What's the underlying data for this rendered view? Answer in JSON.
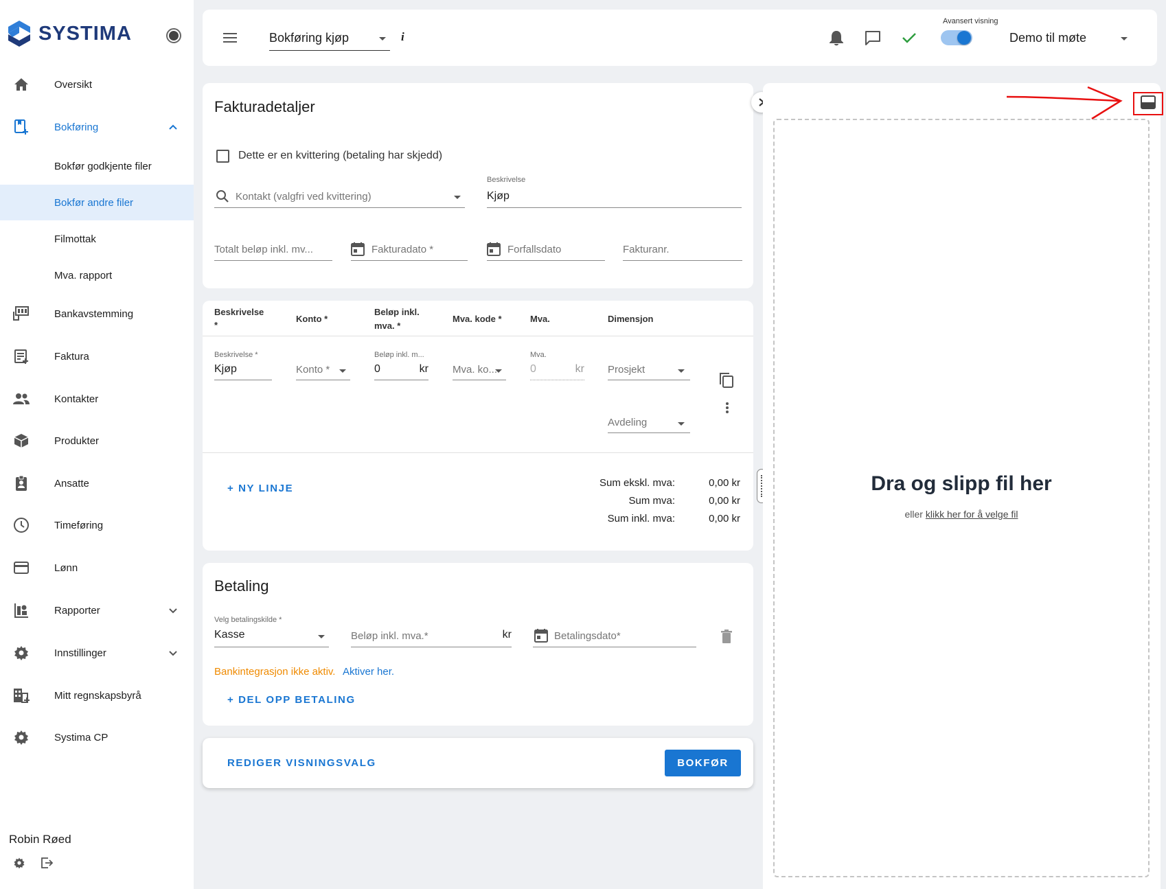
{
  "brand": {
    "name": "SYSTIMA"
  },
  "sidebar": {
    "items": [
      {
        "label": "Oversikt",
        "icon": "home-icon"
      },
      {
        "label": "Bokføring",
        "icon": "book-add-icon"
      },
      {
        "label": "Bokfør godkjente filer"
      },
      {
        "label": "Bokfør andre filer"
      },
      {
        "label": "Filmottak"
      },
      {
        "label": "Mva. rapport"
      },
      {
        "label": "Bankavstemming",
        "icon": "bank-reconcile-icon"
      },
      {
        "label": "Faktura",
        "icon": "invoice-icon"
      },
      {
        "label": "Kontakter",
        "icon": "people-icon"
      },
      {
        "label": "Produkter",
        "icon": "box-icon"
      },
      {
        "label": "Ansatte",
        "icon": "badge-icon"
      },
      {
        "label": "Timeføring",
        "icon": "clock-icon"
      },
      {
        "label": "Lønn",
        "icon": "card-icon"
      },
      {
        "label": "Rapporter",
        "icon": "report-icon"
      },
      {
        "label": "Innstillinger",
        "icon": "gear-icon"
      },
      {
        "label": "Mitt regnskapsbyrå",
        "icon": "building-icon"
      },
      {
        "label": "Systima CP",
        "icon": "gear-icon"
      }
    ],
    "user": {
      "name": "Robin Røed"
    }
  },
  "topbar": {
    "page_select": "Bokføring kjøp",
    "info": "i",
    "advanced_view_label": "Avansert visning",
    "company_select": "Demo til møte"
  },
  "invoice": {
    "title": "Fakturadetaljer",
    "receipt_checkbox": "Dette er en kvittering (betaling har skjedd)",
    "contact_placeholder": "Kontakt (valgfri ved kvittering)",
    "description_label": "Beskrivelse",
    "description_value": "Kjøp",
    "total_placeholder": "Totalt beløp inkl. mv...",
    "invoice_date_placeholder": "Fakturadato *",
    "due_date_placeholder": "Forfallsdato",
    "invoice_no_placeholder": "Fakturanr."
  },
  "lines": {
    "headers": {
      "description_1": "Beskrivelse",
      "description_2": "*",
      "account": "Konto *",
      "amount_1": "Beløp inkl.",
      "amount_2": "mva. *",
      "vat_code": "Mva. kode *",
      "vat": "Mva.",
      "dimension": "Dimensjon"
    },
    "row": {
      "description_label": "Beskrivelse *",
      "description_value": "Kjøp",
      "account_placeholder": "Konto *",
      "amount_label": "Beløp inkl. m...",
      "amount_value": "0",
      "currency": "kr",
      "vat_code_placeholder": "Mva. ko...",
      "vat_label": "Mva.",
      "vat_value": "0",
      "vat_currency": "kr",
      "project_placeholder": "Prosjekt",
      "department_placeholder": "Avdeling"
    },
    "add_line": "+ NY LINJE",
    "sums": [
      {
        "label": "Sum ekskl. mva:",
        "value": "0,00 kr"
      },
      {
        "label": "Sum mva:",
        "value": "0,00 kr"
      },
      {
        "label": "Sum inkl. mva:",
        "value": "0,00 kr"
      }
    ]
  },
  "payment": {
    "title": "Betaling",
    "source_label": "Velg betalingskilde *",
    "source_value": "Kasse",
    "amount_placeholder": "Beløp inkl. mva.*",
    "currency": "kr",
    "date_placeholder": "Betalingsdato*",
    "bank_warning": "Bankintegrasjon ikke aktiv.",
    "bank_link": "Aktiver her.",
    "split": "+ DEL OPP BETALING"
  },
  "footer": {
    "edit_view": "REDIGER VISNINGSVALG",
    "post": "BOKFØR"
  },
  "dropzone": {
    "title": "Dra og slipp fil her",
    "or": "eller",
    "link": "klikk her for å velge fil"
  },
  "colors": {
    "primary": "#1976d2",
    "brand": "#1f3a7a",
    "warning": "#ef8a00",
    "success": "#2e9d3f",
    "annotation": "#e81010"
  }
}
